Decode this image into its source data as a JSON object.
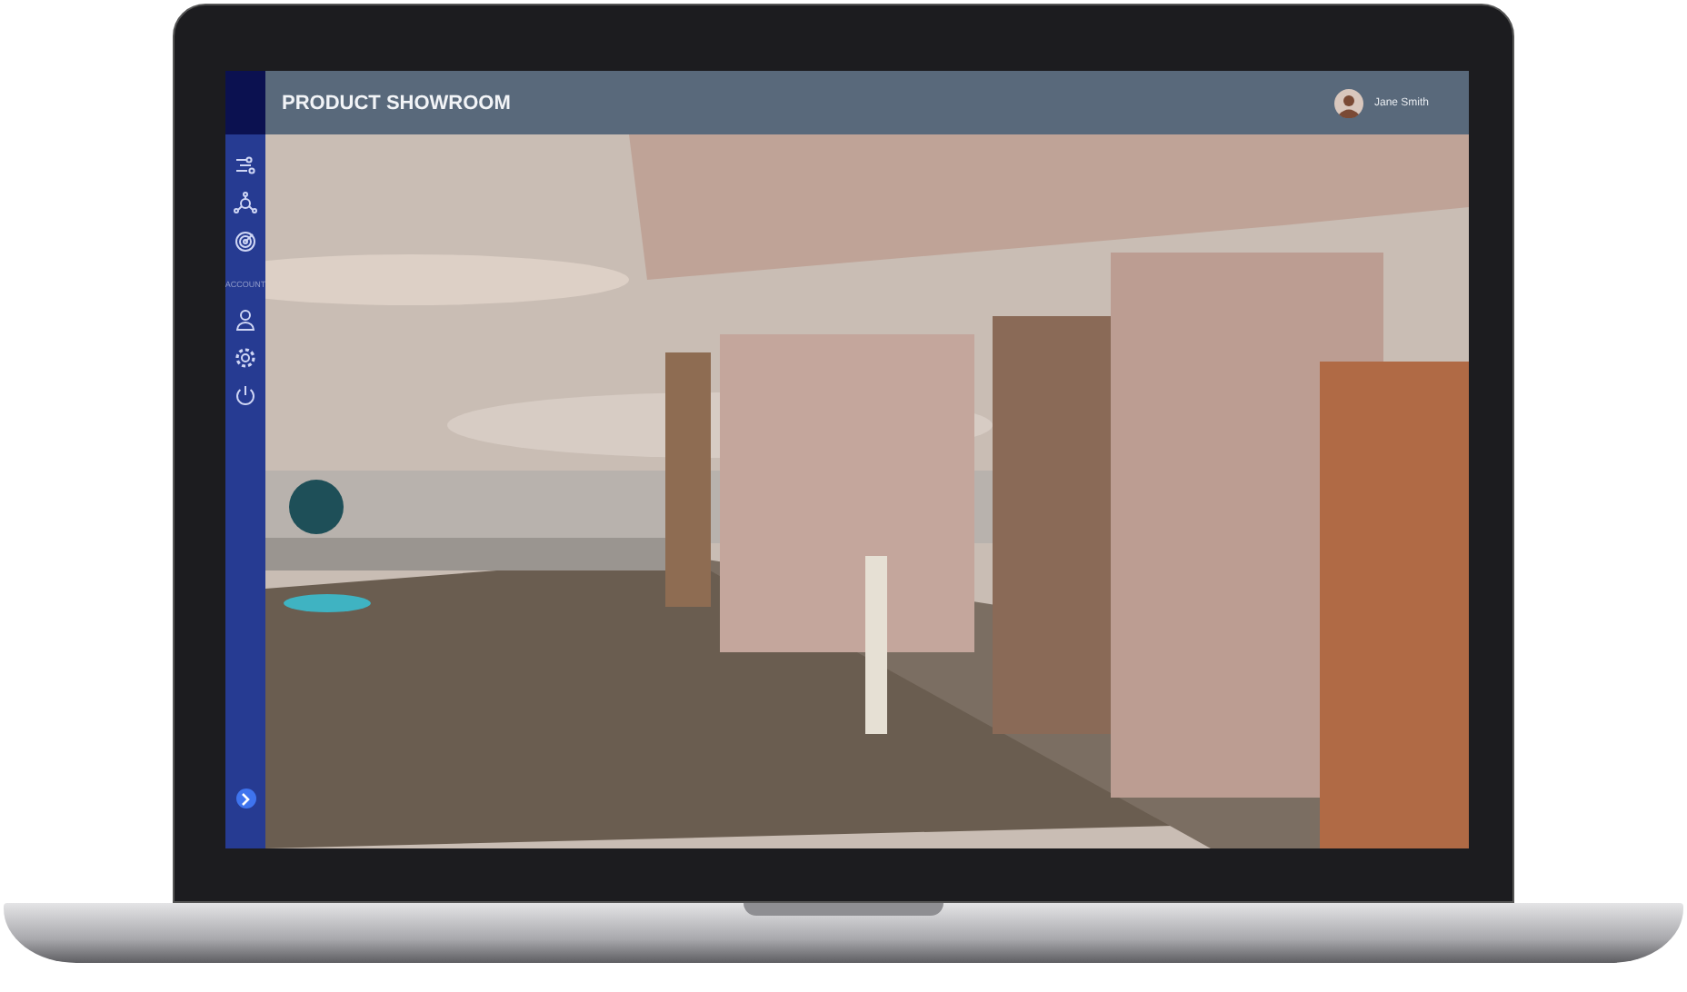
{
  "header": {
    "title": "PRODUCT SHOWROOM",
    "user_name": "Jane Smith"
  },
  "sidebar": {
    "section_label": "ACCOUNT"
  }
}
